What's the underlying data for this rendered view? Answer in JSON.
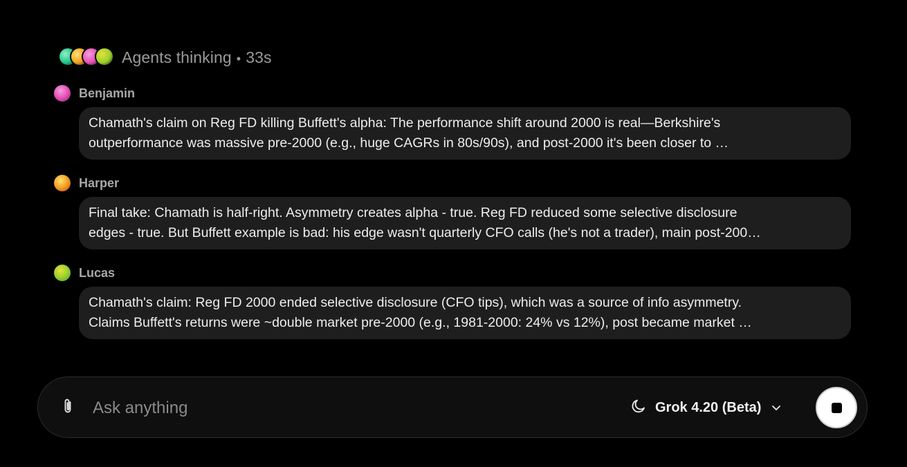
{
  "status": {
    "label": "Agents thinking",
    "elapsed": "33s"
  },
  "agents": [
    {
      "name": "Benjamin",
      "avatar_colors": [
        "#e64fb8",
        "#f2a1d9",
        "#8a2a6b"
      ],
      "lines": [
        "Chamath's claim on Reg FD killing Buffett's alpha: The performance shift around 2000 is real—Berkshire's",
        "outperformance was massive pre-2000 (e.g., huge CAGRs in 80s/90s), and post-2000 it's been closer to …"
      ]
    },
    {
      "name": "Harper",
      "avatar_colors": [
        "#f0a020",
        "#ffe070",
        "#c0401a"
      ],
      "lines": [
        "Final take: Chamath is half-right. Asymmetry creates alpha - true. Reg FD reduced some selective disclosure",
        "edges - true. But Buffett example is bad: his edge wasn't quarterly CFO calls (he's not a trader), main post-200…"
      ]
    },
    {
      "name": "Lucas",
      "avatar_colors": [
        "#9ad02a",
        "#e8e040",
        "#3a9a3a"
      ],
      "lines": [
        "Chamath's claim: Reg FD 2000 ended selective disclosure (CFO tips), which was a source of info asymmetry.",
        "Claims Buffett's returns were ~double market pre-2000 (e.g., 1981-2000: 24% vs 12%), post became market …"
      ]
    }
  ],
  "stack_avatar_colors": [
    [
      "#21c48a",
      "#8ff0c8"
    ],
    [
      "#f0a020",
      "#ffe070"
    ],
    [
      "#e64fb8",
      "#f2a1d9"
    ],
    [
      "#9ad02a",
      "#e8e040"
    ]
  ],
  "composer": {
    "placeholder": "Ask anything",
    "model": "Grok 4.20 (Beta)",
    "icons": {
      "attach": "paperclip-icon",
      "mode": "moon-icon",
      "dropdown": "chevron-down-icon",
      "stop": "stop-icon"
    }
  }
}
